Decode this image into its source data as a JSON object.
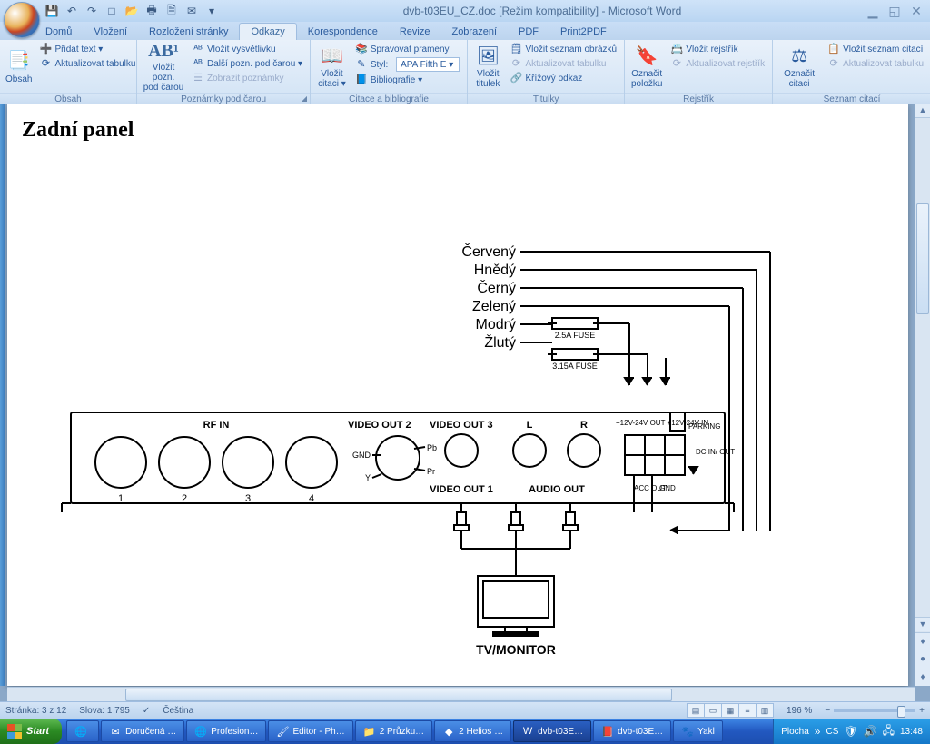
{
  "window": {
    "title_doc": "dvb-t03EU_CZ.doc",
    "title_mode": "[Režim kompatibility]",
    "title_app": "Microsoft Word"
  },
  "qat": {
    "save": "💾",
    "undo": "↶",
    "redo": "↷",
    "new": "□",
    "open": "📂",
    "print": "🖶",
    "preview": "🗎",
    "mail": "✉",
    "more": "▾"
  },
  "tabs": {
    "home": "Domů",
    "insert": "Vložení",
    "layout": "Rozložení stránky",
    "references": "Odkazy",
    "mailings": "Korespondence",
    "review": "Revize",
    "view": "Zobrazení",
    "pdf": "PDF",
    "print2pdf": "Print2PDF"
  },
  "ribbon": {
    "g_obsah": {
      "label": "Obsah",
      "big": "Obsah",
      "add_text": "Přidat text ▾",
      "update": "Aktualizovat tabulku"
    },
    "g_footnotes": {
      "label": "Poznámky pod čarou",
      "big": "Vložit pozn.\npod čarou",
      "ab": "AB¹",
      "endnote": "Vložit vysvětlivku",
      "next": "Další pozn. pod čarou ▾",
      "show": "Zobrazit poznámky"
    },
    "g_citations": {
      "label": "Citace a bibliografie",
      "big": "Vložit\ncitaci ▾",
      "manage": "Spravovat prameny",
      "style_lbl": "Styl:",
      "style_val": "APA Fifth E",
      "style_arrow": "▾",
      "biblio": "Bibliografie ▾"
    },
    "g_captions": {
      "label": "Titulky",
      "big": "Vložit\ntitulek",
      "figlist": "Vložit seznam obrázků",
      "update": "Aktualizovat tabulku",
      "xref": "Křížový odkaz"
    },
    "g_index": {
      "label": "Rejstřík",
      "big": "Označit\npoložku",
      "insert": "Vložit rejstřík",
      "update": "Aktualizovat rejstřík"
    },
    "g_toa": {
      "label": "Seznam citací",
      "big": "Označit\ncitaci",
      "insert": "Vložit seznam citací",
      "update": "Aktualizovat tabulku"
    }
  },
  "doc": {
    "heading": "Zadní panel",
    "wires": {
      "red": "Červený",
      "brown": "Hnědý",
      "black": "Černý",
      "green": "Zelený",
      "blue": "Modrý",
      "yellow": "Žlutý"
    },
    "fuse1": "2.5A FUSE",
    "fuse2": "3.15A FUSE",
    "rf_in": "RF IN",
    "vout1": "VIDEO OUT 1",
    "vout2": "VIDEO OUT 2",
    "vout3": "VIDEO OUT 3",
    "audio_out": "AUDIO OUT",
    "l": "L",
    "r": "R",
    "gnd": "GND",
    "y": "Y",
    "pb": "Pb",
    "pr": "Pr",
    "power": "+12V-24V OUT\n+12V-24V IN",
    "parking": "PARKING",
    "dc": "DC\nIN/\nOUT",
    "acc": "ACC\nOUT",
    "gnd2": "GND",
    "tv": "TV/MONITOR",
    "n1": "1",
    "n2": "2",
    "n3": "3",
    "n4": "4"
  },
  "status": {
    "page": "Stránka: 3 z 12",
    "words": "Slova: 1 795",
    "lang": "Čeština",
    "zoom": "196 %",
    "checkmark": "✓"
  },
  "taskbar": {
    "start": "Start",
    "items": [
      {
        "icon": "🌐",
        "label": "",
        "cls": ""
      },
      {
        "icon": "✉",
        "label": "Doručená …",
        "cls": ""
      },
      {
        "icon": "🌐",
        "label": "Profesion…",
        "cls": ""
      },
      {
        "icon": "🖌",
        "label": "Editor - Ph…",
        "cls": ""
      },
      {
        "icon": "📁",
        "label": "2 Průzku…",
        "cls": ""
      },
      {
        "icon": "◆",
        "label": "2 Helios …",
        "cls": ""
      },
      {
        "icon": "W",
        "label": "dvb-t03E…",
        "cls": "active"
      },
      {
        "icon": "📕",
        "label": "dvb-t03E…",
        "cls": ""
      },
      {
        "icon": "🐾",
        "label": "Yakl",
        "cls": ""
      }
    ],
    "tray": {
      "desktop": "Plocha",
      "lang": "CS",
      "time": "13:48"
    }
  }
}
